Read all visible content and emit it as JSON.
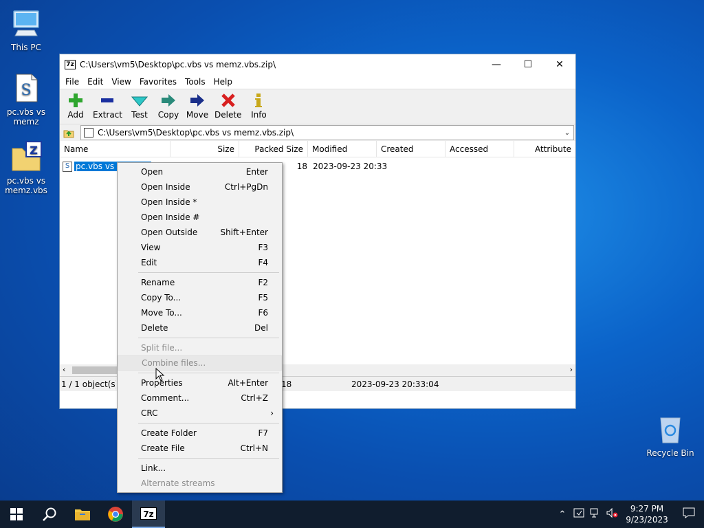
{
  "desktop": {
    "icons": [
      {
        "label": "This PC"
      },
      {
        "label": "pc.vbs vs memz"
      },
      {
        "label": "pc.vbs vs memz.vbs"
      },
      {
        "label": "Recycle Bin"
      }
    ]
  },
  "window": {
    "title": "C:\\Users\\vm5\\Desktop\\pc.vbs vs memz.vbs.zip\\",
    "app_icon": "7z",
    "controls": {
      "minimize": "—",
      "maximize": "☐",
      "close": "✕"
    },
    "menu": [
      "File",
      "Edit",
      "View",
      "Favorites",
      "Tools",
      "Help"
    ],
    "toolbar": [
      {
        "label": "Add",
        "icon": "plus-icon",
        "color": "#2fa62f"
      },
      {
        "label": "Extract",
        "icon": "minus-icon",
        "color": "#1a2fa0"
      },
      {
        "label": "Test",
        "icon": "check-icon",
        "color": "#1fb5b5"
      },
      {
        "label": "Copy",
        "icon": "copy-arrow-icon",
        "color": "#2a8a7a"
      },
      {
        "label": "Move",
        "icon": "move-arrow-icon",
        "color": "#1a2f8a"
      },
      {
        "label": "Delete",
        "icon": "x-icon",
        "color": "#d81f1f"
      },
      {
        "label": "Info",
        "icon": "info-icon",
        "color": "#c8a81a"
      }
    ],
    "address": "C:\\Users\\vm5\\Desktop\\pc.vbs vs memz.vbs.zip\\",
    "columns": [
      "Name",
      "Size",
      "Packed Size",
      "Modified",
      "Created",
      "Accessed",
      "Attribute"
    ],
    "file": {
      "name": "pc.vbs vs m",
      "packed_size": "18",
      "modified": "2023-09-23 20:33"
    },
    "status": {
      "selection": "1 / 1 object(s) se",
      "size": "18",
      "modified": "2023-09-23 20:33:04"
    }
  },
  "context_menu": {
    "groups": [
      [
        {
          "label": "Open",
          "shortcut": "Enter",
          "disabled": false
        },
        {
          "label": "Open Inside",
          "shortcut": "Ctrl+PgDn",
          "disabled": false
        },
        {
          "label": "Open Inside *",
          "shortcut": "",
          "disabled": false
        },
        {
          "label": "Open Inside #",
          "shortcut": "",
          "disabled": false
        },
        {
          "label": "Open Outside",
          "shortcut": "Shift+Enter",
          "disabled": false
        },
        {
          "label": "View",
          "shortcut": "F3",
          "disabled": false
        },
        {
          "label": "Edit",
          "shortcut": "F4",
          "disabled": false
        }
      ],
      [
        {
          "label": "Rename",
          "shortcut": "F2",
          "disabled": false
        },
        {
          "label": "Copy To...",
          "shortcut": "F5",
          "disabled": false
        },
        {
          "label": "Move To...",
          "shortcut": "F6",
          "disabled": false
        },
        {
          "label": "Delete",
          "shortcut": "Del",
          "disabled": false
        }
      ],
      [
        {
          "label": "Split file...",
          "shortcut": "",
          "disabled": true
        },
        {
          "label": "Combine files...",
          "shortcut": "",
          "disabled": true
        }
      ],
      [
        {
          "label": "Properties",
          "shortcut": "Alt+Enter",
          "disabled": false
        },
        {
          "label": "Comment...",
          "shortcut": "Ctrl+Z",
          "disabled": false
        },
        {
          "label": "CRC",
          "shortcut": "›",
          "disabled": false
        }
      ],
      [
        {
          "label": "Create Folder",
          "shortcut": "F7",
          "disabled": false
        },
        {
          "label": "Create File",
          "shortcut": "Ctrl+N",
          "disabled": false
        }
      ],
      [
        {
          "label": "Link...",
          "shortcut": "",
          "disabled": false
        },
        {
          "label": "Alternate streams",
          "shortcut": "",
          "disabled": true
        }
      ]
    ]
  },
  "taskbar": {
    "items": [
      "start-icon",
      "search-icon",
      "file-explorer-icon",
      "chrome-icon",
      "7zip-icon"
    ],
    "active_label": "7z",
    "clock": {
      "time": "9:27 PM",
      "date": "9/23/2023"
    }
  },
  "colors": {
    "accent": "#0078d7",
    "selection": "#0078d7",
    "taskbar": "#101d2e"
  }
}
